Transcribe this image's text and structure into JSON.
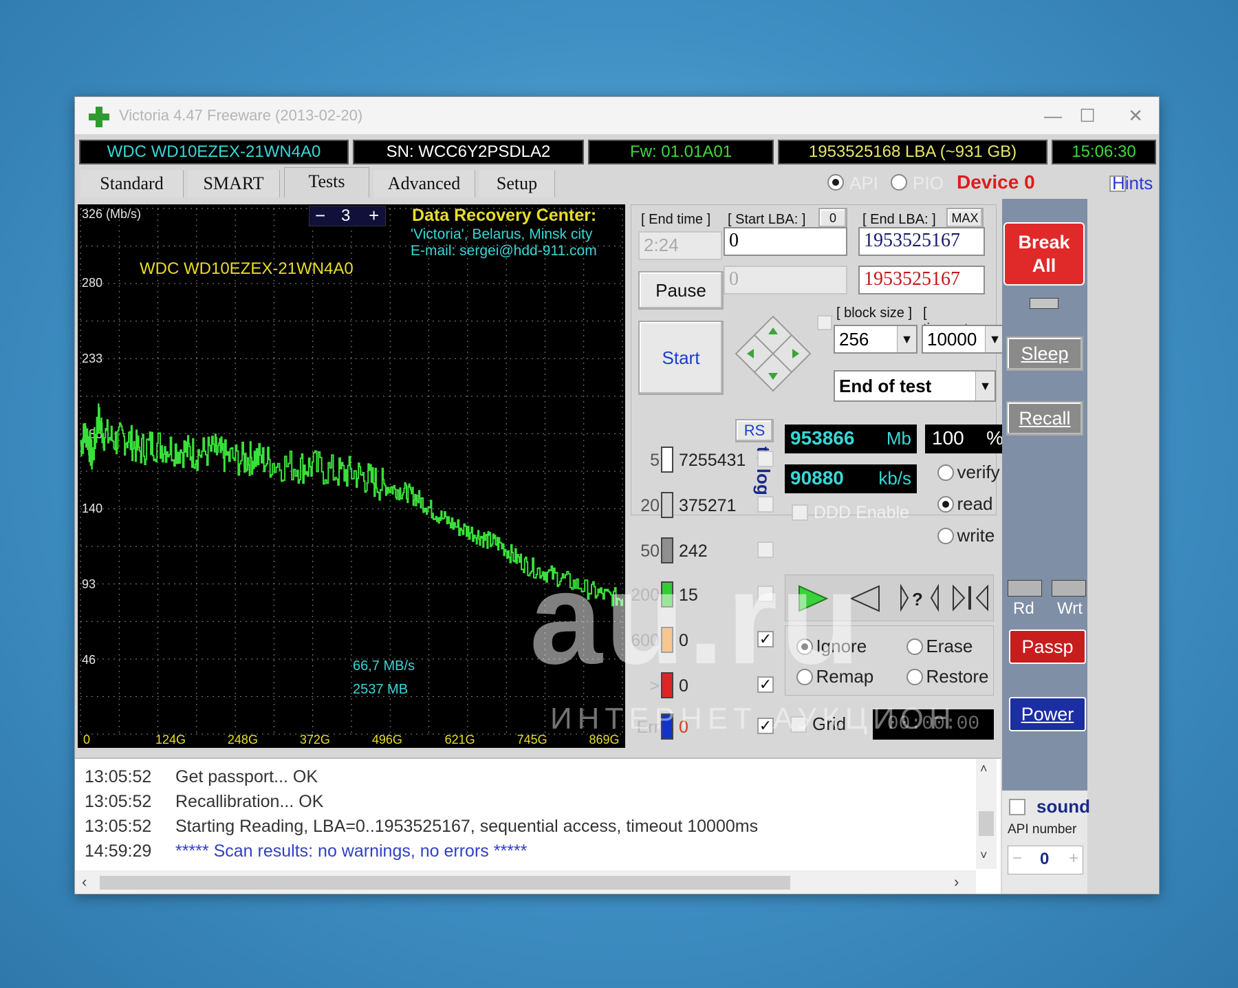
{
  "window": {
    "title": "Victoria 4.47  Freeware (2013-02-20)",
    "minimize": "—",
    "maximize": "☐",
    "close": "✕"
  },
  "infobar": {
    "model": "WDC WD10EZEX-21WN4A0",
    "serial": "SN: WCC6Y2PSDLA2",
    "firmware": "Fw: 01.01A01",
    "capacity": "1953525168 LBA (~931 GB)",
    "clock": "15:06:30"
  },
  "tabs": [
    "Standard",
    "SMART",
    "Tests",
    "Advanced",
    "Setup"
  ],
  "active_tab": "Tests",
  "top_right": {
    "api_label": "API",
    "pio_label": "PIO",
    "device": "Device 0",
    "hints": "Hints"
  },
  "graph": {
    "ylabel": "326 (Mb/s)",
    "y_ticks": [
      "280",
      "233",
      "186",
      "140",
      "93",
      "46"
    ],
    "x_ticks": [
      "0",
      "124G",
      "248G",
      "372G",
      "496G",
      "621G",
      "745G",
      "869G"
    ],
    "zoom_minus": "−",
    "zoom_value": "3",
    "zoom_plus": "+",
    "banner_title": "Data Recovery Center:",
    "banner_line1": "'Victoria', Belarus, Minsk city",
    "banner_line2": "E-mail: sergei@hdd-911.com",
    "drive_label": "WDC WD10EZEX-21WN4A0",
    "speed_text": "66,7 MB/s",
    "size_text": "2537 MB"
  },
  "chart_data": {
    "type": "line",
    "ylabel": "326 (Mb/s)",
    "ylim": [
      0,
      326
    ],
    "xlim": [
      0,
      931
    ],
    "x": [
      0,
      10,
      20,
      30,
      40,
      60,
      80,
      100,
      124,
      150,
      180,
      200,
      230,
      248,
      280,
      300,
      330,
      372,
      400,
      440,
      470,
      496,
      520,
      540,
      560,
      580,
      600,
      621,
      650,
      680,
      700,
      720,
      745,
      770,
      800,
      830,
      869,
      900,
      931
    ],
    "values": [
      180,
      188,
      170,
      196,
      186,
      182,
      184,
      176,
      180,
      178,
      176,
      174,
      176,
      172,
      170,
      172,
      168,
      166,
      166,
      162,
      162,
      158,
      154,
      152,
      150,
      146,
      140,
      134,
      128,
      124,
      120,
      118,
      110,
      104,
      100,
      96,
      90,
      86,
      84
    ]
  },
  "test_params": {
    "end_time_label": "[ End time ]",
    "end_time": "2:24",
    "start_lba_label": "[ Start LBA: ]",
    "start_lba_btn": "0",
    "start_lba": "0",
    "start_lba_cur": "0",
    "end_lba_label": "[ End LBA: ]",
    "end_lba_btn": "MAX",
    "end_lba": "1953525167",
    "end_lba_cur": "1953525167",
    "pause": "Pause",
    "start": "Start",
    "block_size_label": "[ block size ]",
    "block_size": "256",
    "timeout_label": "[ timeout,ms ]",
    "timeout": "10000",
    "end_action": "End of test"
  },
  "legend": {
    "rs": "RS",
    "to_log": "to log:",
    "rows": [
      {
        "ms": "5",
        "count": "7255431",
        "color": "#ffffff"
      },
      {
        "ms": "20",
        "count": "375271",
        "color": "#d2d2d2"
      },
      {
        "ms": "50",
        "count": "242",
        "color": "#8f8f8f"
      },
      {
        "ms": "200",
        "count": "15",
        "color": "#33cc33"
      },
      {
        "ms": "600",
        "count": "0",
        "color": "#f08c1e"
      },
      {
        "ms": ">",
        "count": "0",
        "color": "#e02424"
      },
      {
        "ms": "Err",
        "count": "0",
        "color": "#1133cc"
      }
    ]
  },
  "stats": {
    "mb_value": "953866",
    "mb_unit": "Mb",
    "percent_value": "100",
    "percent_unit": "%",
    "kbs_value": "90880",
    "kbs_unit": "kb/s",
    "ddd": "DDD Enable"
  },
  "mode": {
    "verify": "verify",
    "read": "read",
    "write": "write",
    "selected": "read"
  },
  "actions": {
    "ignore": "Ignore",
    "erase": "Erase",
    "remap": "Remap",
    "restore": "Restore",
    "selected": "Ignore"
  },
  "grid": {
    "label": "Grid",
    "timer": "00:00:00"
  },
  "sidebar": {
    "break_all": "Break All",
    "sleep": "Sleep",
    "recall": "Recall",
    "rd": "Rd",
    "wrt": "Wrt",
    "passp": "Passp",
    "power": "Power",
    "sound": "sound",
    "api_number_label": "API number",
    "api_number": "0"
  },
  "log": [
    {
      "time": "13:05:52",
      "text": "Get passport... OK",
      "color": "#333333"
    },
    {
      "time": "13:05:52",
      "text": "Recallibration... OK",
      "color": "#333333"
    },
    {
      "time": "13:05:52",
      "text": "Starting Reading, LBA=0..1953525167, sequential access, timeout 10000ms",
      "color": "#333333"
    },
    {
      "time": "14:59:29",
      "text": "***** Scan results: no warnings, no errors *****",
      "color": "#2f3fc7"
    }
  ],
  "watermark": {
    "main": "au.ru",
    "sub": "ИНТЕРНЕТ-АУКЦИОН"
  }
}
